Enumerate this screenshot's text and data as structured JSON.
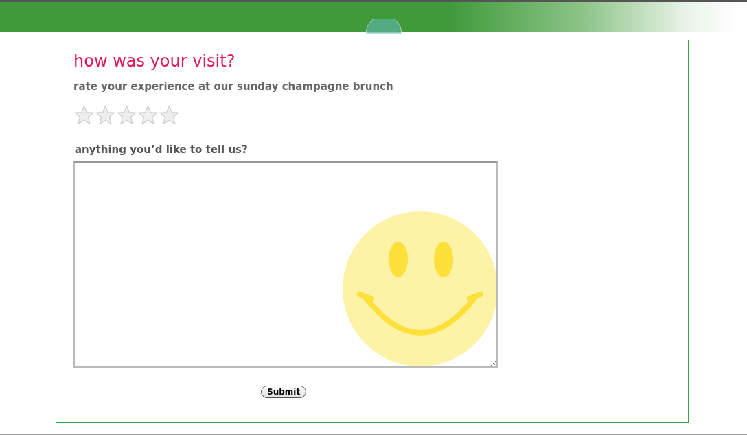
{
  "title": "how was your visit?",
  "rating": {
    "label": "rate your experience at our sunday champagne brunch",
    "stars": 0
  },
  "comment": {
    "label": "anything you’d like to tell us?"
  },
  "submit": "Submit"
}
